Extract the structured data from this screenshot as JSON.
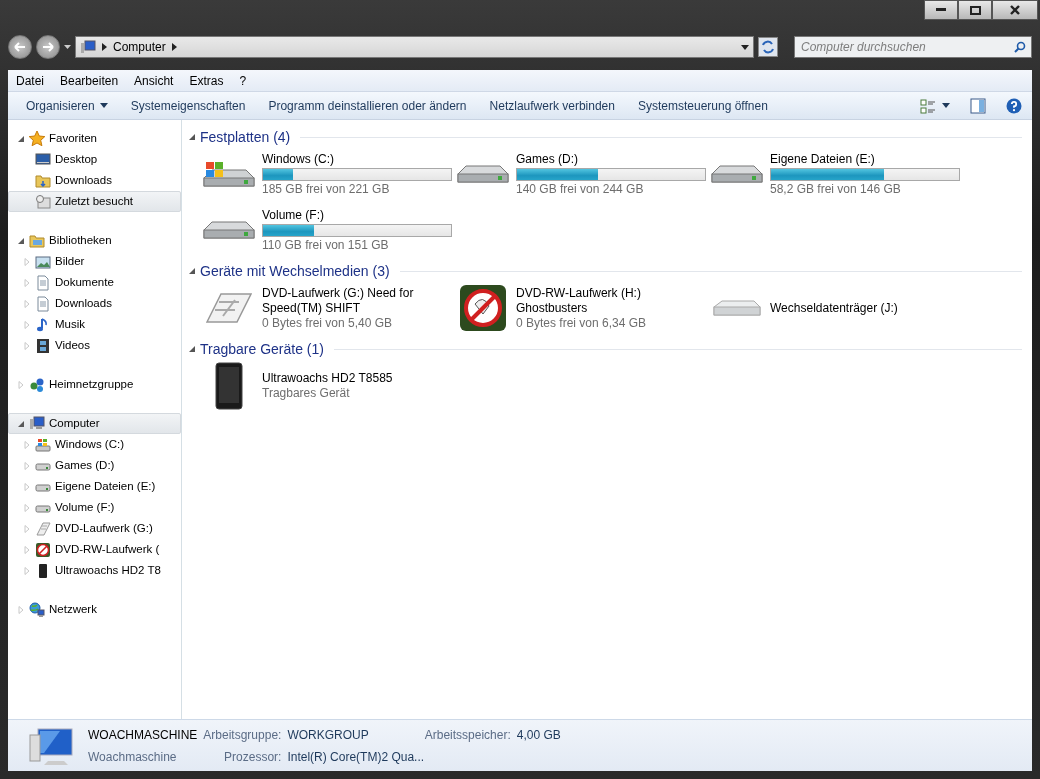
{
  "address_bar": {
    "path": [
      "Computer"
    ]
  },
  "search": {
    "placeholder": "Computer durchsuchen"
  },
  "menu": [
    "Datei",
    "Bearbeiten",
    "Ansicht",
    "Extras",
    "?"
  ],
  "commands": [
    {
      "label": "Organisieren",
      "dropdown": true
    },
    {
      "label": "Systemeigenschaften",
      "dropdown": false
    },
    {
      "label": "Programm deinstallieren oder ändern",
      "dropdown": false
    },
    {
      "label": "Netzlaufwerk verbinden",
      "dropdown": false
    },
    {
      "label": "Systemsteuerung öffnen",
      "dropdown": false
    }
  ],
  "sidebar": [
    {
      "label": "Favoriten",
      "kind": "star",
      "expanded": true,
      "selected": false,
      "children": [
        {
          "label": "Desktop",
          "kind": "desktop",
          "selected": false
        },
        {
          "label": "Downloads",
          "kind": "folder",
          "selected": false
        },
        {
          "label": "Zuletzt besucht",
          "kind": "recent",
          "selected": true
        }
      ]
    },
    {
      "label": "Bibliotheken",
      "kind": "library",
      "expanded": true,
      "selected": false,
      "children": [
        {
          "label": "Bilder",
          "kind": "pictures",
          "selected": false
        },
        {
          "label": "Dokumente",
          "kind": "document",
          "selected": false
        },
        {
          "label": "Downloads",
          "kind": "document",
          "selected": false
        },
        {
          "label": "Musik",
          "kind": "music",
          "selected": false
        },
        {
          "label": "Videos",
          "kind": "film",
          "selected": false
        }
      ]
    },
    {
      "label": "Heimnetzgruppe",
      "kind": "network",
      "expanded": false,
      "selected": false
    },
    {
      "label": "Computer",
      "kind": "computer",
      "expanded": true,
      "selected": true,
      "children": [
        {
          "label": "Windows (C:)",
          "kind": "windows-hdd",
          "selected": false
        },
        {
          "label": "Games (D:)",
          "kind": "hdd",
          "selected": false
        },
        {
          "label": "Eigene Dateien (E:)",
          "kind": "hdd",
          "selected": false
        },
        {
          "label": "Volume (F:)",
          "kind": "hdd",
          "selected": false
        },
        {
          "label": "DVD-Laufwerk (G:)",
          "kind": "dvd",
          "selected": false
        },
        {
          "label": "DVD-RW-Laufwerk (",
          "kind": "ghost",
          "selected": false
        },
        {
          "label": "Ultrawoachs HD2 T8",
          "kind": "phone",
          "selected": false
        }
      ]
    },
    {
      "label": "Netzwerk",
      "kind": "globe",
      "expanded": false,
      "selected": false
    }
  ],
  "groups": [
    {
      "title": "Festplatten (4)",
      "items": [
        {
          "name": "Windows (C:)",
          "kind": "windows-hdd",
          "level": 0.16,
          "detail": "185 GB frei von 221 GB"
        },
        {
          "name": "Games (D:)",
          "kind": "hdd",
          "level": 0.43,
          "detail": "140 GB frei von 244 GB"
        },
        {
          "name": "Eigene Dateien (E:)",
          "kind": "hdd",
          "level": 0.6,
          "detail": "58,2 GB frei von 146 GB"
        },
        {
          "name": "Volume (F:)",
          "kind": "hdd",
          "level": 0.27,
          "detail": "110 GB frei von 151 GB"
        }
      ]
    },
    {
      "title": "Geräte mit Wechselmedien (3)",
      "items": [
        {
          "name": "DVD-Laufwerk (G:) Need for Speed(TM) SHIFT",
          "kind": "dvd",
          "detail": "0 Bytes frei von 5,40 GB"
        },
        {
          "name": "DVD-RW-Laufwerk (H:) Ghostbusters",
          "kind": "ghost",
          "detail": "0 Bytes frei von 6,34 GB"
        },
        {
          "name": "Wechseldatenträger (J:)",
          "kind": "removable"
        }
      ]
    },
    {
      "title": "Tragbare Geräte (1)",
      "items": [
        {
          "name": "Ultrawoachs HD2 T8585",
          "kind": "phone",
          "detail": "Tragbares Gerät"
        }
      ]
    }
  ],
  "details": {
    "name": "WOACHMASCHINE",
    "description": "Woachmaschine",
    "fields": [
      {
        "label": "Arbeitsgruppe:",
        "value": "WORKGROUP"
      },
      {
        "label": "Arbeitsspeicher:",
        "value": "4,00 GB"
      },
      {
        "label": "Prozessor:",
        "value": "Intel(R) Core(TM)2 Qua..."
      }
    ]
  }
}
